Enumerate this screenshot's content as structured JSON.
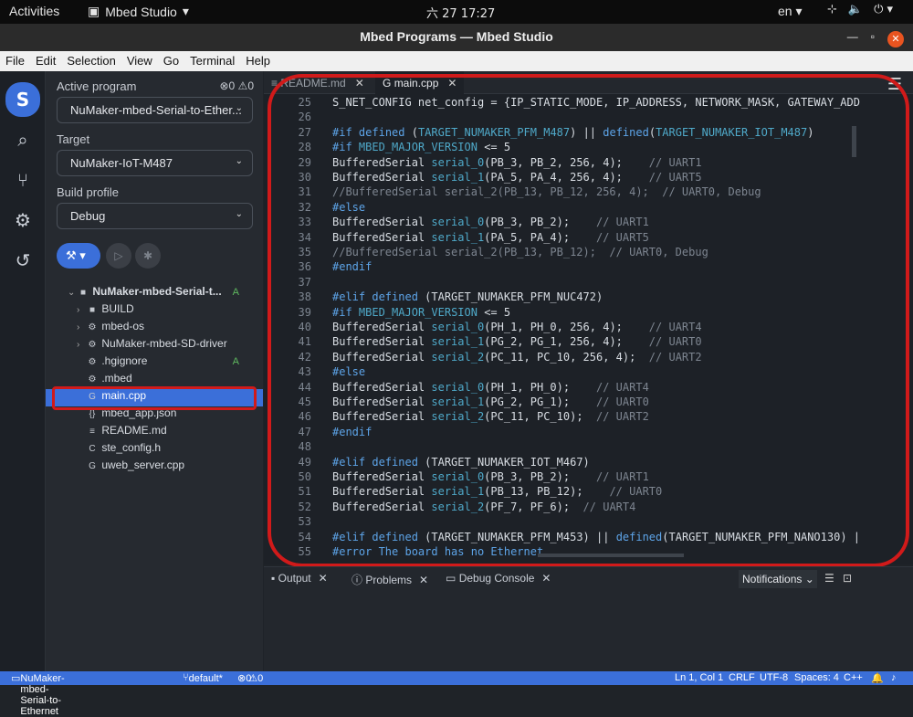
{
  "system_bar": {
    "activities": "Activities",
    "app_name": "Mbed Studio",
    "clock": "六 27  17:27",
    "lang": "en"
  },
  "window": {
    "title": "Mbed Programs — Mbed Studio"
  },
  "menu": [
    "File",
    "Edit",
    "Selection",
    "View",
    "Go",
    "Terminal",
    "Help"
  ],
  "sidebar": {
    "active_program_label": "Active program",
    "errors": "0",
    "warnings": "0",
    "active_program": "NuMaker-mbed-Serial-to-Ether...",
    "target_label": "Target",
    "target": "NuMaker-IoT-M487",
    "profile_label": "Build profile",
    "profile": "Debug",
    "tree": [
      {
        "name": "NuMaker-mbed-Serial-t...",
        "badge": "A"
      },
      {
        "name": "BUILD",
        "badge": ""
      },
      {
        "name": "mbed-os",
        "badge": ""
      },
      {
        "name": "NuMaker-mbed-SD-driver",
        "badge": ""
      },
      {
        "name": ".hgignore",
        "badge": "A"
      },
      {
        "name": ".mbed",
        "badge": ""
      },
      {
        "name": "main.cpp",
        "badge": ""
      },
      {
        "name": "mbed_app.json",
        "badge": ""
      },
      {
        "name": "README.md",
        "badge": ""
      },
      {
        "name": "ste_config.h",
        "badge": ""
      },
      {
        "name": "uweb_server.cpp",
        "badge": ""
      }
    ]
  },
  "editor": {
    "tabs": [
      {
        "label": "README.md"
      },
      {
        "label": "main.cpp"
      }
    ],
    "lines": [
      {
        "n": "25",
        "t": "S_NET_CONFIG net_config = {IP_STATIC_MODE, IP_ADDRESS, NETWORK_MASK, GATEWAY_ADD"
      },
      {
        "n": "26",
        "t": ""
      },
      {
        "n": "27",
        "t": "#if defined (TARGET_NUMAKER_PFM_M487) || defined(TARGET_NUMAKER_IOT_M487)"
      },
      {
        "n": "28",
        "t": "#if MBED_MAJOR_VERSION <= 5"
      },
      {
        "n": "29",
        "t": "BufferedSerial serial_0(PB_3, PB_2, 256, 4);    // UART1"
      },
      {
        "n": "30",
        "t": "BufferedSerial serial_1(PA_5, PA_4, 256, 4);    // UART5"
      },
      {
        "n": "31",
        "t": "//BufferedSerial serial_2(PB_13, PB_12, 256, 4);  // UART0, Debug"
      },
      {
        "n": "32",
        "t": "#else"
      },
      {
        "n": "33",
        "t": "BufferedSerial serial_0(PB_3, PB_2);    // UART1"
      },
      {
        "n": "34",
        "t": "BufferedSerial serial_1(PA_5, PA_4);    // UART5"
      },
      {
        "n": "35",
        "t": "//BufferedSerial serial_2(PB_13, PB_12);  // UART0, Debug"
      },
      {
        "n": "36",
        "t": "#endif"
      },
      {
        "n": "37",
        "t": ""
      },
      {
        "n": "38",
        "t": "#elif defined (TARGET_NUMAKER_PFM_NUC472)"
      },
      {
        "n": "39",
        "t": "#if MBED_MAJOR_VERSION <= 5"
      },
      {
        "n": "40",
        "t": "BufferedSerial serial_0(PH_1, PH_0, 256, 4);    // UART4"
      },
      {
        "n": "41",
        "t": "BufferedSerial serial_1(PG_2, PG_1, 256, 4);    // UART0"
      },
      {
        "n": "42",
        "t": "BufferedSerial serial_2(PC_11, PC_10, 256, 4);  // UART2"
      },
      {
        "n": "43",
        "t": "#else"
      },
      {
        "n": "44",
        "t": "BufferedSerial serial_0(PH_1, PH_0);    // UART4"
      },
      {
        "n": "45",
        "t": "BufferedSerial serial_1(PG_2, PG_1);    // UART0"
      },
      {
        "n": "46",
        "t": "BufferedSerial serial_2(PC_11, PC_10);  // UART2"
      },
      {
        "n": "47",
        "t": "#endif"
      },
      {
        "n": "48",
        "t": ""
      },
      {
        "n": "49",
        "t": "#elif defined (TARGET_NUMAKER_IOT_M467)"
      },
      {
        "n": "50",
        "t": "BufferedSerial serial_0(PB_3, PB_2);    // UART1"
      },
      {
        "n": "51",
        "t": "BufferedSerial serial_1(PB_13, PB_12);    // UART0"
      },
      {
        "n": "52",
        "t": "BufferedSerial serial_2(PF_7, PF_6);  // UART4"
      },
      {
        "n": "53",
        "t": ""
      },
      {
        "n": "54",
        "t": "#elif defined (TARGET_NUMAKER_PFM_M453) || defined(TARGET_NUMAKER_PFM_NANO130) |"
      },
      {
        "n": "55",
        "t": "#error The board has no Ethernet."
      }
    ]
  },
  "panel": {
    "tabs": [
      "Output",
      "Problems",
      "Debug Console"
    ],
    "notifications": "Notifications"
  },
  "status": {
    "program": "NuMaker-mbed-Serial-to-Ethernet",
    "branch": "default*",
    "errors": "0",
    "warnings": "0",
    "cursor": "Ln 1, Col 1",
    "eol": "CRLF",
    "encoding": "UTF-8",
    "indent": "Spaces: 4",
    "lang": "C++"
  },
  "colors": {
    "accent": "#3b6fd9",
    "highlight": "#d11a1a"
  }
}
